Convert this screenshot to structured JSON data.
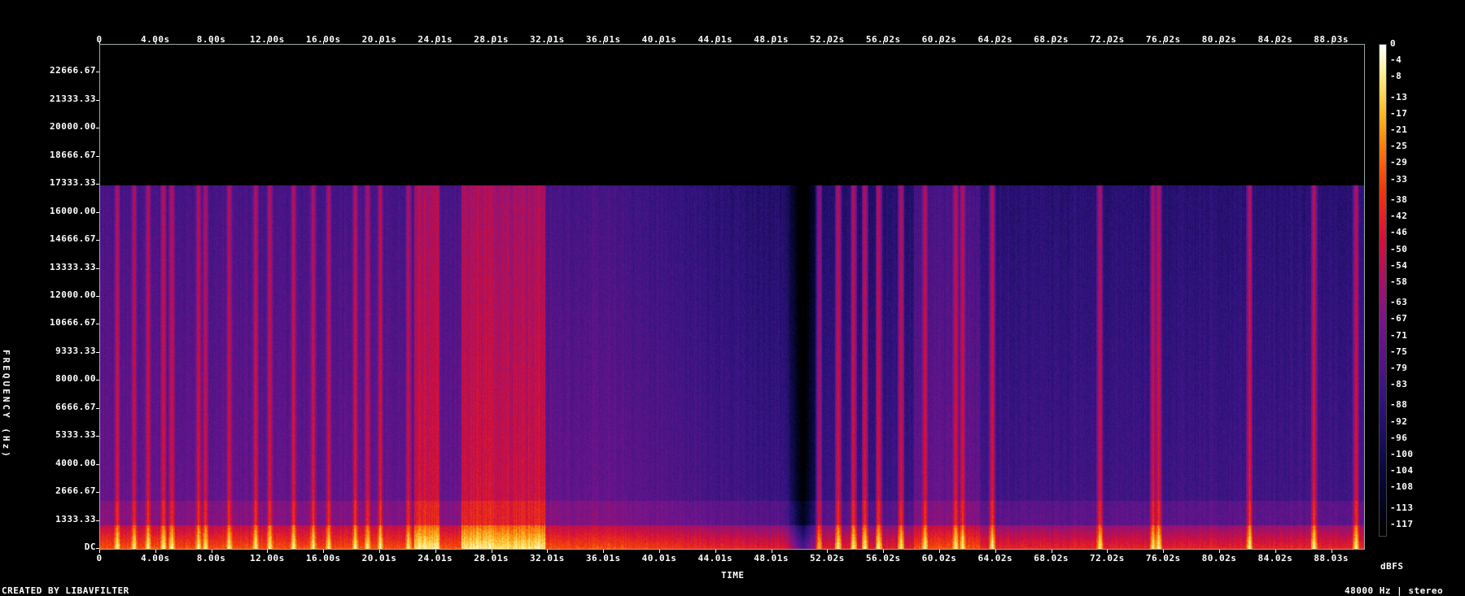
{
  "chart_data": {
    "type": "heatmap",
    "title": "",
    "xlabel": "TIME",
    "ylabel": "FREQUENCY (Hz)",
    "x_ticks": [
      "0",
      "4.00s",
      "8.00s",
      "12.00s",
      "16.00s",
      "20.01s",
      "24.01s",
      "28.01s",
      "32.01s",
      "36.01s",
      "40.01s",
      "44.01s",
      "48.01s",
      "52.02s",
      "56.02s",
      "60.02s",
      "64.02s",
      "68.02s",
      "72.02s",
      "76.02s",
      "80.02s",
      "84.02s",
      "88.03s"
    ],
    "y_ticks": [
      "DC",
      "1333.33",
      "2666.67",
      "4000.00",
      "5333.33",
      "6666.67",
      "8000.00",
      "9333.33",
      "10666.67",
      "12000.00",
      "13333.33",
      "14666.67",
      "16000.00",
      "17333.33",
      "18666.67",
      "20000.00",
      "21333.33",
      "22666.67"
    ],
    "xlim": [
      0,
      90.3
    ],
    "ylim": [
      0,
      24000
    ],
    "colorbar": {
      "label": "dBFS",
      "ticks": [
        "0",
        "-4",
        "-8",
        "-13",
        "-17",
        "-21",
        "-25",
        "-29",
        "-33",
        "-38",
        "-42",
        "-46",
        "-50",
        "-54",
        "-58",
        "-63",
        "-67",
        "-71",
        "-75",
        "-79",
        "-83",
        "-88",
        "-92",
        "-96",
        "-100",
        "-104",
        "-108",
        "-113",
        "-117"
      ],
      "range": [
        -120,
        0
      ]
    },
    "cutoff_hz": 17333,
    "dropout_seconds": 50.2,
    "loud_regions_s": [
      [
        22.4,
        24.2
      ],
      [
        25.8,
        31.8
      ]
    ],
    "transients_s": [
      1.2,
      2.4,
      3.4,
      4.5,
      5.1,
      7.0,
      7.5,
      9.2,
      11.1,
      12.1,
      13.8,
      15.2,
      16.3,
      18.2,
      19.1,
      20.0,
      22.0,
      23.5,
      30.6,
      31.2,
      51.3,
      52.7,
      53.8,
      54.6,
      55.6,
      57.2,
      58.9,
      61.1,
      61.6,
      63.7,
      71.4,
      75.2,
      75.6,
      82.1,
      86.7,
      89.7
    ]
  },
  "footer": {
    "credit": "CREATED BY LIBAVFILTER",
    "info": "48000 Hz | stereo"
  }
}
